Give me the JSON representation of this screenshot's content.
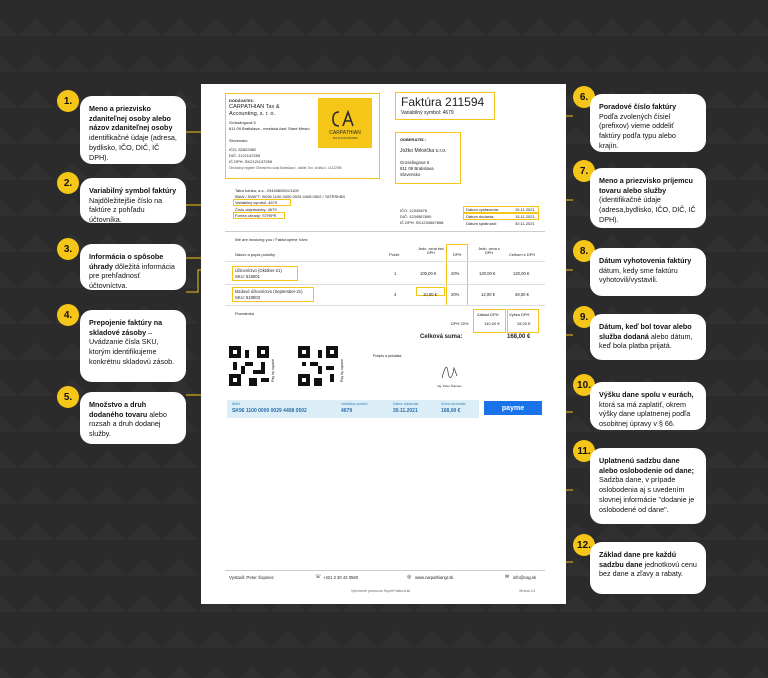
{
  "callouts": [
    {
      "n": "1.",
      "bold": "Meno a priezvisko zdaniteľnej osoby alebo názov zdaniteľnej osoby",
      "text": " identifikačné údaje (adresa, bydlisko, IČO, DIČ, IČ DPH)."
    },
    {
      "n": "2.",
      "bold": "Variabilný symbol faktúry",
      "text": " Najdôležitejšie číslo na faktúre z pohľadu účtovníka."
    },
    {
      "n": "3.",
      "bold": "Informácia o spôsobe úhrady",
      "text": " dôležitá informácia pre prehľadnosť účtovníctva."
    },
    {
      "n": "4.",
      "bold": "Prepojenie faktúry na skladové zásoby",
      "text": " – Uvádzanie čísla SKU, ktorým identifikujeme konkrétnu skladovú zásob."
    },
    {
      "n": "5.",
      "bold": "Množstvo a druh dodaného tovaru",
      "text": " alebo rozsah a druh dodanej služby."
    },
    {
      "n": "6.",
      "bold": "Poradové číslo faktúry",
      "text": " Podľa zvolených čísiel (prefixov) vieme oddeliť faktúry podľa typu alebo krajín."
    },
    {
      "n": "7.",
      "bold": "Meno a priezvisko príjemcu tovaru alebo služby",
      "text": " (identifikačné údaje (adresa,bydlisko, IČO, DIČ, IČ DPH)."
    },
    {
      "n": "8.",
      "bold": "Dátum vyhotovenia faktúry",
      "text": " dátum, kedy sme faktúru vyhotovili/vystavili."
    },
    {
      "n": "9.",
      "bold": "Dátum, keď bol tovar alebo služba dodaná",
      "text": " alebo dátum, keď bola platba prijatá."
    },
    {
      "n": "10.",
      "bold": "Výšku dane spolu v eurách,",
      "text": " ktorá sa má zaplatiť, okrem výšky dane uplatnenej podľa osobitnej úpravy v § 66."
    },
    {
      "n": "11.",
      "bold": "Uplatnenú sadzbu dane alebo oslobodenie od dane;",
      "text": " Sadzba dane, v prípade oslobodenia aj s uvedením slovnej informácie \"dodanie je oslobodené od dane\"."
    },
    {
      "n": "12.",
      "bold": "Základ dane pre každú sadzbu dane",
      "text": " jednotkovú cenu bez dane a zľavy a rabaty."
    }
  ],
  "invoice": {
    "supplier_label": "DODÁVATEĽ:",
    "supplier_name": "CARPATHIAN Tax & Accounting, s. r. o.",
    "supplier_street": "Grösslingová 5",
    "supplier_city": "811 09 Bratislava - mestská časť Staré Mesto",
    "supplier_country": "Slovensko",
    "supplier_ico": "IČO: 52822982",
    "supplier_dic": "DIČ: 2121147259",
    "supplier_icdph": "IČ DPH: SK2121147259",
    "supplier_register": "Obchodný register Okresného súdu Bratislava I, oddiel: Sro, vložka č. 141229/B",
    "logo_text": "CARPATHIAN",
    "logo_sub": "TAX & ACCOUNTING",
    "title": "Faktúra 211594",
    "vs_header": "Variabilný symbol: 4679",
    "customer_label": "ODBERATEĽ:",
    "customer_name": "Jožko Mrkvička s.r.o.",
    "customer_street": "Grosslingova 5",
    "customer_city": "811 09 Bratislava",
    "customer_country": "Slovensko",
    "bank": "Tatra banka, a.s.: 2944080501/1100",
    "iban": "IBAN / SWIFT: SK96 1100 0000 0029 4408 0502 / TATRSKBX",
    "vs_line": "Variabilný symbol: 4679",
    "order_no": "Číslo objednávky: 4679",
    "payment": "Forma úhrady: STRIPE",
    "c_ico": "IČO: 12345678",
    "c_dic": "DIČ: 1234567890",
    "c_icdph": "IČ DPH: SK1234567898",
    "d_issue_l": "Dátum vystavenia:",
    "d_issue": "15.11.2021",
    "d_supply_l": "Dátum dodania:",
    "d_supply": "15.11.2021",
    "d_due_l": "Dátum splatnosti:",
    "d_due": "30.11.2021",
    "invoicing_note": "We are invoicing you / Fakturujeme Vám:",
    "th_name": "Názov a popis položky",
    "th_qty": "Počet",
    "th_unit": "Jedn. cena bez DPH",
    "th_vat": "DPH",
    "th_unit_vat": "Jedn. cena s DPH",
    "th_total": "Celkom s DPH",
    "rows": [
      {
        "name": "Účtovníctvo (Október-21)",
        "sku": "SKU: 518001",
        "qty": "1",
        "unit": "100,00 €",
        "vat": "20%",
        "unit_vat": "120,00 €",
        "total": "120,00 €"
      },
      {
        "name": "Mzdové účtovníctvo (September-21)",
        "sku": "SKU: 518003",
        "qty": "4",
        "unit": "10,00 €",
        "vat": "20%",
        "unit_vat": "12,00 €",
        "total": "48,00 €"
      }
    ],
    "note": "Poznámka",
    "base_l": "Základ DPH",
    "vat_amount_l": "Výška DPH",
    "vat_rate": "DPH 20%",
    "base_v": "140,00 €",
    "vat_v": "28,00 €",
    "total_l": "Celková suma:",
    "total_v": "168,00 €",
    "pay_square": "Pay by square",
    "sign_l": "Podpis a pečiatka",
    "sign_name": "Ing. Peter Šopinec",
    "iban_l": "IBAN",
    "iban_v": "SK96 1100 0000 0029 4408 0502",
    "vs_l": "Variabilný symbol",
    "vs_v": "4679",
    "due_l": "Dátum splatnosti",
    "due_v": "30.11.2021",
    "sum_l": "Suma na úhradu",
    "sum_v": "168,00 €",
    "payme": "payme",
    "issued_by": "Vystavil: Peter Šopinec",
    "phone": "+421 2 20 42 0560",
    "web": "www.carpathiangr.sk",
    "email": "info@cag.sk",
    "generated": "Vytvorené pomocou SuperFaktura.sk",
    "page_no": "Strana 1/1"
  }
}
